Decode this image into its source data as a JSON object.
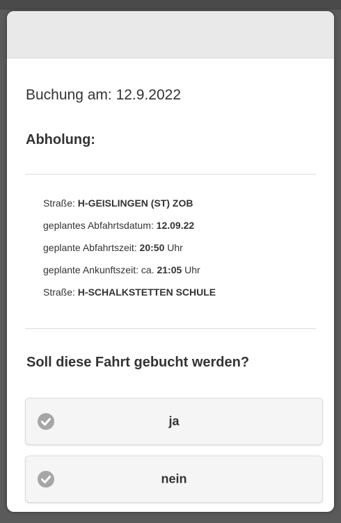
{
  "booking": {
    "date_label": "Buchung am: 12.9.2022"
  },
  "pickup": {
    "heading": "Abholung:",
    "details": [
      {
        "label": "Straße:",
        "value": "H-GEISLINGEN (ST) ZOB",
        "suffix": ""
      },
      {
        "label": "geplantes Abfahrtsdatum:",
        "value": "12.09.22",
        "suffix": ""
      },
      {
        "label": "geplante Abfahrtszeit:",
        "value": "20:50",
        "suffix": "Uhr"
      },
      {
        "label": "geplante Ankunftszeit: ca.",
        "value": "21:05",
        "suffix": "Uhr"
      },
      {
        "label": "Straße:",
        "value": "H-SCHALKSTETTEN SCHULE",
        "suffix": ""
      }
    ]
  },
  "question": "Soll diese Fahrt gebucht werden?",
  "choices": {
    "yes": {
      "label": "ja",
      "icon": "check-circle-icon"
    },
    "no": {
      "label": "nein",
      "icon": "check-circle-icon"
    }
  },
  "colors": {
    "icon_gray": "#a6a6a6",
    "header_bg": "#e9e9e9",
    "button_bg": "#f5f5f5"
  }
}
